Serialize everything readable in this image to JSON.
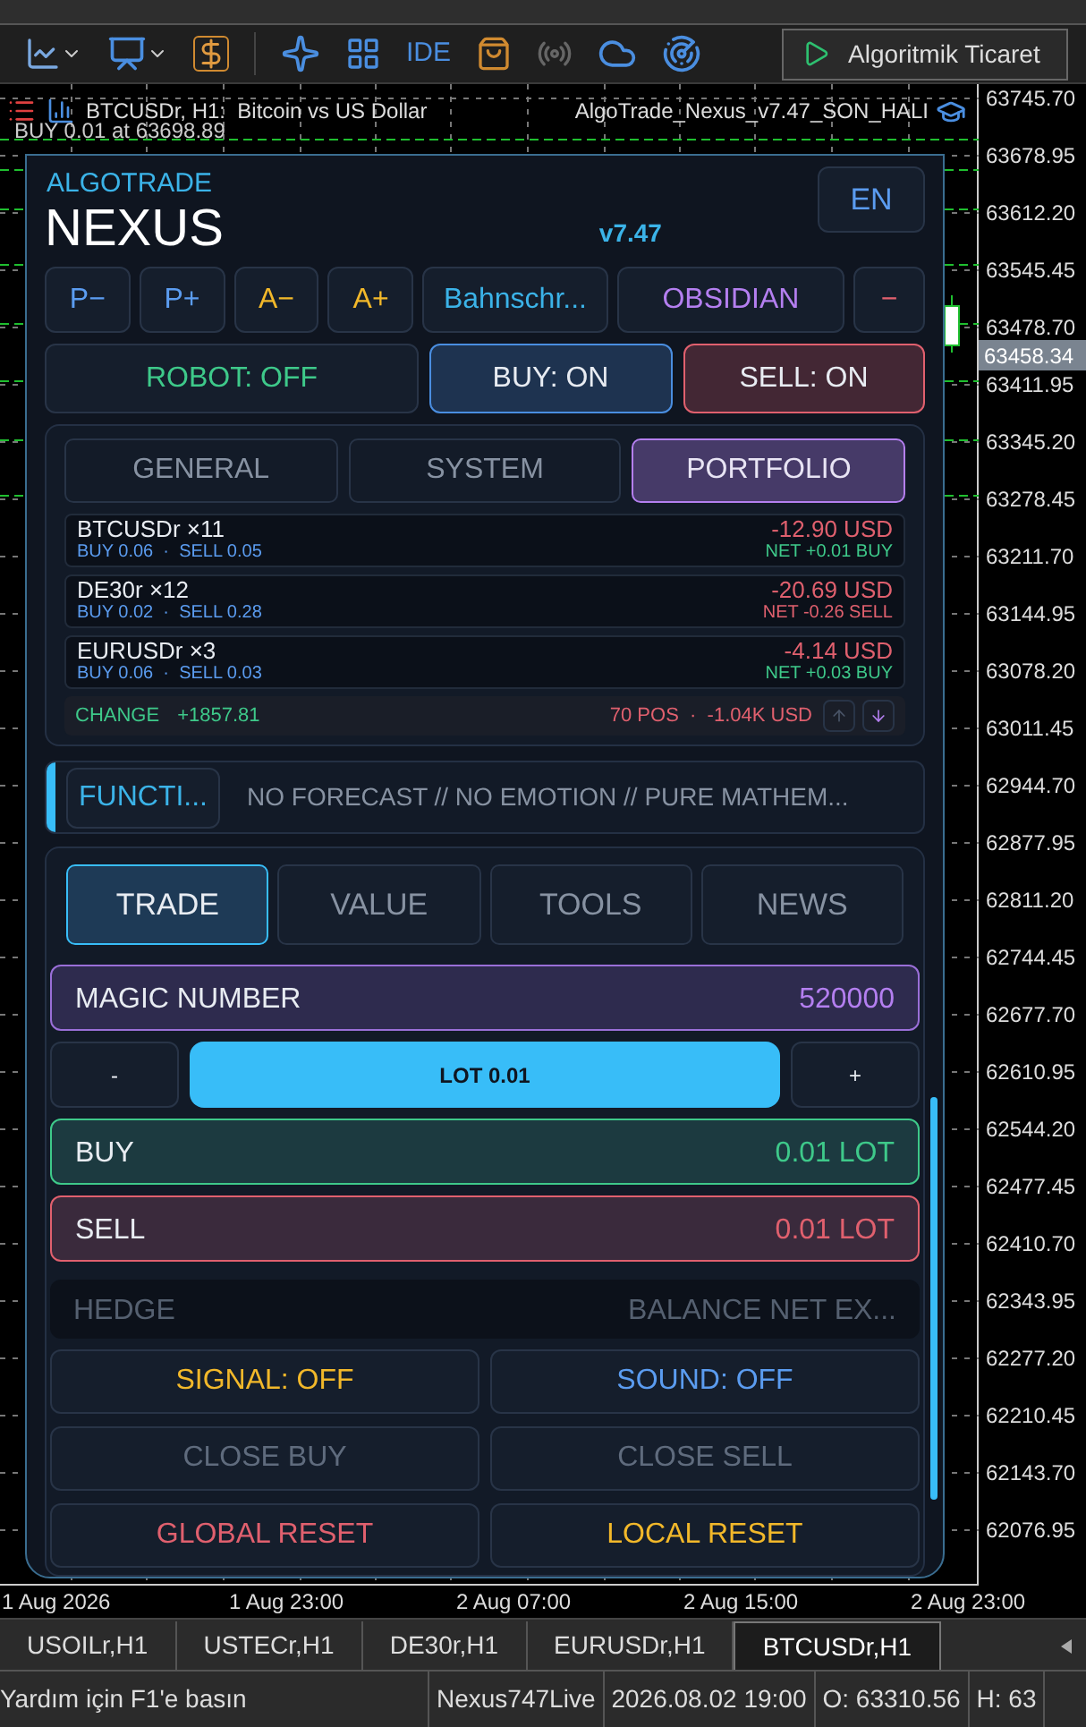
{
  "toolbar": {
    "ide_label": "IDE",
    "algo_button": "Algoritmik Ticaret"
  },
  "chart": {
    "symbol_title": "BTCUSDr, H1:  Bitcoin vs US Dollar",
    "expert": "AlgoTrade_Nexus_v7.47_SON_HALI",
    "trade_label": "BUY 0.01 at 63698.89",
    "price_labels": [
      "63745.70",
      "63678.95",
      "63612.20",
      "63545.45",
      "63478.70",
      "63411.95",
      "63345.20",
      "63278.45",
      "63211.70",
      "63144.95",
      "63078.20",
      "63011.45",
      "62944.70",
      "62877.95",
      "62811.20",
      "62744.45",
      "62677.70",
      "62610.95",
      "62544.20",
      "62477.45",
      "62410.70",
      "62343.95",
      "62277.20",
      "62210.45",
      "62143.70",
      "62076.95"
    ],
    "current_price": "63458.34",
    "time_labels": [
      "1 Aug 2026",
      "1 Aug 23:00",
      "2 Aug 07:00",
      "2 Aug 15:00",
      "2 Aug 23:00"
    ]
  },
  "panel": {
    "brand": "ALGOTRADE",
    "title": "NEXUS",
    "version": "v7.47",
    "language": "EN",
    "tool_buttons": [
      {
        "label": "P−",
        "color": "#5b9cf0"
      },
      {
        "label": "P+",
        "color": "#5b9cf0"
      },
      {
        "label": "A−",
        "color": "#f2b82a"
      },
      {
        "label": "A+",
        "color": "#f2b82a"
      },
      {
        "label": "Bahnschr...",
        "color": "#3bb3e8"
      },
      {
        "label": "OBSIDIAN",
        "color": "#b47ff0"
      },
      {
        "label": "−",
        "color": "#e0606e"
      }
    ],
    "toggles": [
      {
        "label": "ROBOT: OFF",
        "on": false,
        "color": "#3ec98a"
      },
      {
        "label": "BUY: ON",
        "on": true,
        "color": "#4a8ee0"
      },
      {
        "label": "SELL: ON",
        "on": true,
        "color": "#e0606e"
      }
    ],
    "section_tabs": [
      {
        "label": "GENERAL",
        "selected": false
      },
      {
        "label": "SYSTEM",
        "selected": false
      },
      {
        "label": "PORTFOLIO",
        "selected": true
      }
    ],
    "positions": [
      {
        "symbol": "BTCUSDr ×11",
        "sides": "BUY 0.06  ·  SELL 0.05",
        "pnl": "-12.90 USD",
        "net": "NET +0.01 BUY",
        "kind": "buy"
      },
      {
        "symbol": "DE30r ×12",
        "sides": "BUY 0.02  ·  SELL 0.28",
        "pnl": "-20.69 USD",
        "net": "NET -0.26 SELL",
        "kind": "sell"
      },
      {
        "symbol": "EURUSDr ×3",
        "sides": "BUY 0.06  ·  SELL 0.03",
        "pnl": "-4.14 USD",
        "net": "NET +0.03 BUY",
        "kind": "buy"
      }
    ],
    "summary": {
      "change_label": "CHANGE",
      "change": "+1857.81",
      "totals": "70 POS  ·  -1.04K USD"
    },
    "function": {
      "button": "FUNCTI...",
      "motto": "NO FORECAST // NO EMOTION // PURE MATHEM..."
    },
    "trade_tabs": [
      {
        "label": "TRADE",
        "selected": true
      },
      {
        "label": "VALUE",
        "selected": false
      },
      {
        "label": "TOOLS",
        "selected": false
      },
      {
        "label": "NEWS",
        "selected": false
      }
    ],
    "magic": {
      "label": "MAGIC NUMBER",
      "value": "520000"
    },
    "lot": {
      "minus": "-",
      "value": "LOT 0.01",
      "plus": "+"
    },
    "orders": [
      {
        "label": "BUY",
        "value": "0.01 LOT",
        "kind": "buy"
      },
      {
        "label": "SELL",
        "value": "0.01 LOT",
        "kind": "sell"
      }
    ],
    "hedge": {
      "label": "HEDGE",
      "value": "BALANCE NET EX...",
      "disabled": true
    },
    "actions": [
      {
        "label": "SIGNAL: OFF",
        "color": "#f2b82a"
      },
      {
        "label": "SOUND: OFF",
        "color": "#5b9cf0"
      },
      {
        "label": "CLOSE BUY",
        "color": "#5f6b7d"
      },
      {
        "label": "CLOSE SELL",
        "color": "#5f6b7d"
      },
      {
        "label": "GLOBAL RESET",
        "color": "#e0606e"
      },
      {
        "label": "LOCAL RESET",
        "color": "#f2b82a"
      }
    ]
  },
  "chart_tabs": [
    {
      "label": "USOILr,H1",
      "selected": false
    },
    {
      "label": "USTECr,H1",
      "selected": false
    },
    {
      "label": "DE30r,H1",
      "selected": false
    },
    {
      "label": "EURUSDr,H1",
      "selected": false
    },
    {
      "label": "BTCUSDr,H1",
      "selected": true
    }
  ],
  "status_bar": [
    "Yardım için F1'e basın",
    "Nexus747Live",
    "2026.08.02 19:00",
    "O: 63310.56",
    "H: 63"
  ]
}
